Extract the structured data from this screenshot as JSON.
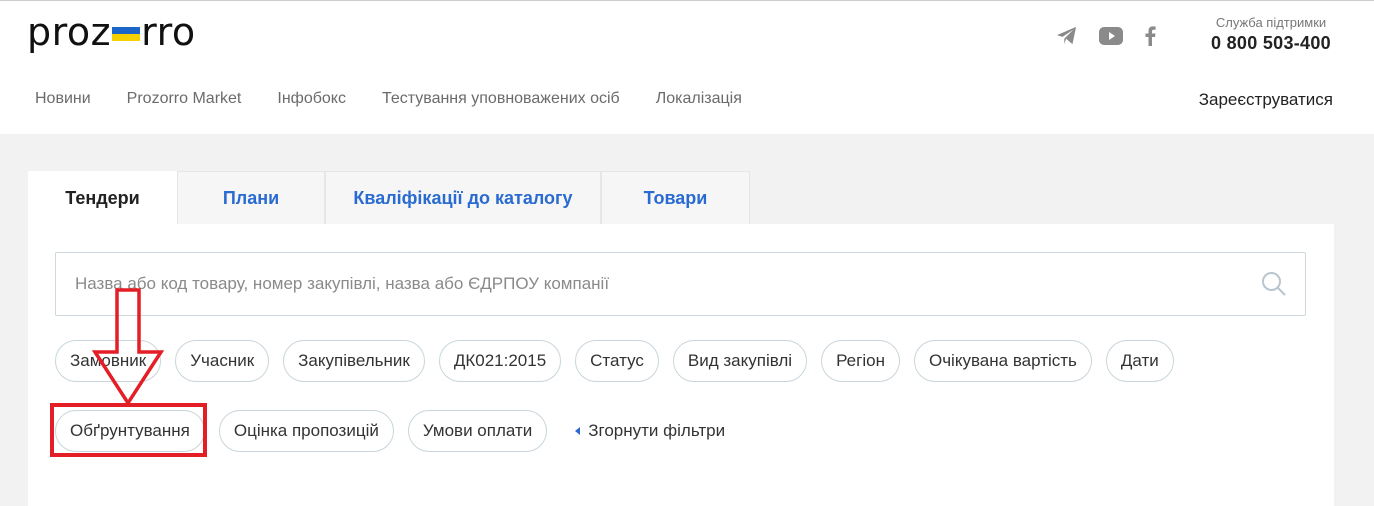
{
  "header": {
    "logo_left": "proz",
    "logo_right": "rro",
    "support_label": "Служба підтримки",
    "support_phone": "0 800 503-400",
    "social_icons": [
      "telegram-icon",
      "youtube-icon",
      "facebook-icon"
    ]
  },
  "nav": {
    "items": [
      {
        "label": "Новини"
      },
      {
        "label": "Prozorro Market"
      },
      {
        "label": "Інфобокс"
      },
      {
        "label": "Тестування уповноважених осіб"
      },
      {
        "label": "Локалізація"
      }
    ],
    "register_label": "Зареєструватися"
  },
  "tabs": [
    {
      "label": "Тендери",
      "active": true
    },
    {
      "label": "Плани",
      "active": false
    },
    {
      "label": "Кваліфікації до каталогу",
      "active": false
    },
    {
      "label": "Товари",
      "active": false
    }
  ],
  "search": {
    "placeholder": "Назва або код товару, номер закупівлі, назва або ЄДРПОУ компанії",
    "value": ""
  },
  "filters": {
    "row1": [
      "Замовник",
      "Учасник",
      "Закупівельник",
      "ДК021:2015",
      "Статус",
      "Вид закупівлі",
      "Регіон",
      "Очікувана вартість",
      "Дати"
    ],
    "row2": [
      "Обґрунтування",
      "Оцінка пропозицій",
      "Умови оплати"
    ],
    "collapse_label": "Згорнути фільтри"
  },
  "colors": {
    "accent": "#2a6bd1",
    "annotation_red": "#e41e26",
    "flag_blue": "#1c66c9",
    "flag_yellow": "#f7d000"
  }
}
